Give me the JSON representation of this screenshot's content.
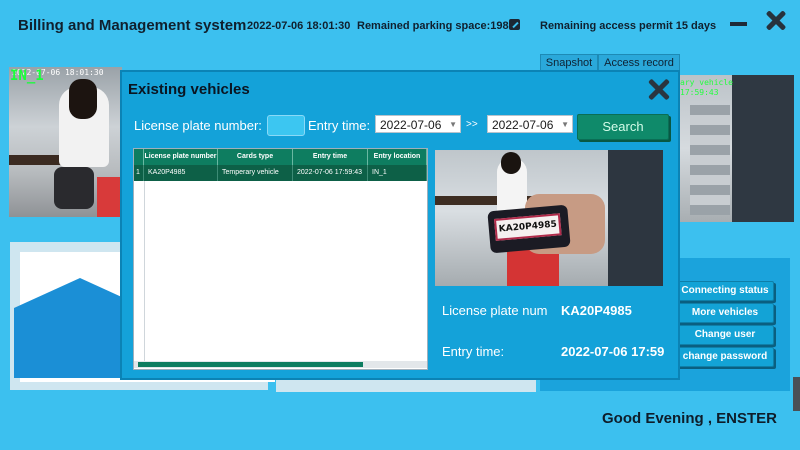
{
  "header": {
    "app_title": "Billing and Management system",
    "datetime": "2022-07-06 18:01:30",
    "parking": "Remained parking space:198",
    "permit": "Remaining access permit 15 days"
  },
  "cameras": {
    "left_overlay": "2022-07-06 18:01:30",
    "left_label": "IN_1",
    "right_overlay_1": "ary vehicle",
    "right_overlay_2": "17:59:43"
  },
  "tabs": {
    "snapshot": "Snapshot",
    "access_record": "Access record"
  },
  "side_buttons": [
    "Connecting status",
    "More vehicles",
    "Change user",
    "change password"
  ],
  "greeting": "Good Evening , ENSTER",
  "modal": {
    "title": "Existing vehicles",
    "plate_label": "License plate number:",
    "plate_value": "",
    "entry_label": "Entry time:",
    "date_from": "2022-07-06",
    "date_to": "2022-07-06",
    "range_sep": ">>",
    "search_label": "Search",
    "table": {
      "headers": [
        "License plate number",
        "Cards type",
        "Entry time",
        "Entry location"
      ],
      "rows": [
        {
          "index": "1",
          "plate": "KA20P4985",
          "card": "Temperary vehicle",
          "time": "2022-07-06 17:59:43",
          "location": "IN_1"
        }
      ]
    },
    "photo_plate": "KA20P4985",
    "plate_num_label": "License plate num",
    "plate_num_value": "KA20P4985",
    "entry_time_label": "Entry time:",
    "entry_time_value": "2022-07-06 17:59"
  }
}
